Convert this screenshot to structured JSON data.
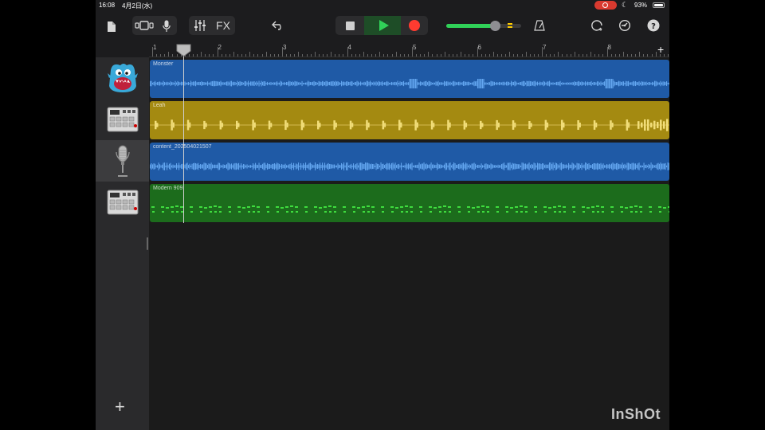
{
  "status_bar": {
    "time": "16:08",
    "date": "4月2日(水)",
    "battery_percent": "93%",
    "battery_level": 0.93,
    "screen_recording": true
  },
  "toolbar": {
    "fx_label": "FX",
    "icons": [
      "document-icon",
      "view-toggle-icon",
      "microphone-icon",
      "mixer-icon",
      "fx-button",
      "undo-icon",
      "stop-icon",
      "play-icon",
      "record-icon",
      "volume-slider",
      "count-in-icon",
      "metronome-icon",
      "loop-icon",
      "settings-icon",
      "help-icon"
    ],
    "volume_level": 0.65
  },
  "ruler": {
    "bars": [
      "1",
      "2",
      "3",
      "4",
      "5",
      "6",
      "7",
      "8"
    ],
    "add_label": "+"
  },
  "tracks": [
    {
      "name": "Monster",
      "instrument": "monster-drummer-icon",
      "color": "#1f5aa6",
      "wave_color": "#63a6f0",
      "kind": "audio"
    },
    {
      "name": "Leah",
      "instrument": "beat-sequencer-icon",
      "color": "#a48a11",
      "wave_color": "#f1dd78",
      "kind": "drum"
    },
    {
      "name": "content_20250402150​7",
      "instrument": "microphone-icon",
      "color": "#1f5aa6",
      "wave_color": "#63a6f0",
      "kind": "audio"
    },
    {
      "name": "Modern 909",
      "instrument": "beat-sequencer-icon",
      "color": "#1c6c1c",
      "wave_color": "#3edb3e",
      "kind": "pattern"
    }
  ],
  "selected_track": 2,
  "add_track_label": "+",
  "watermark": "InShOt"
}
